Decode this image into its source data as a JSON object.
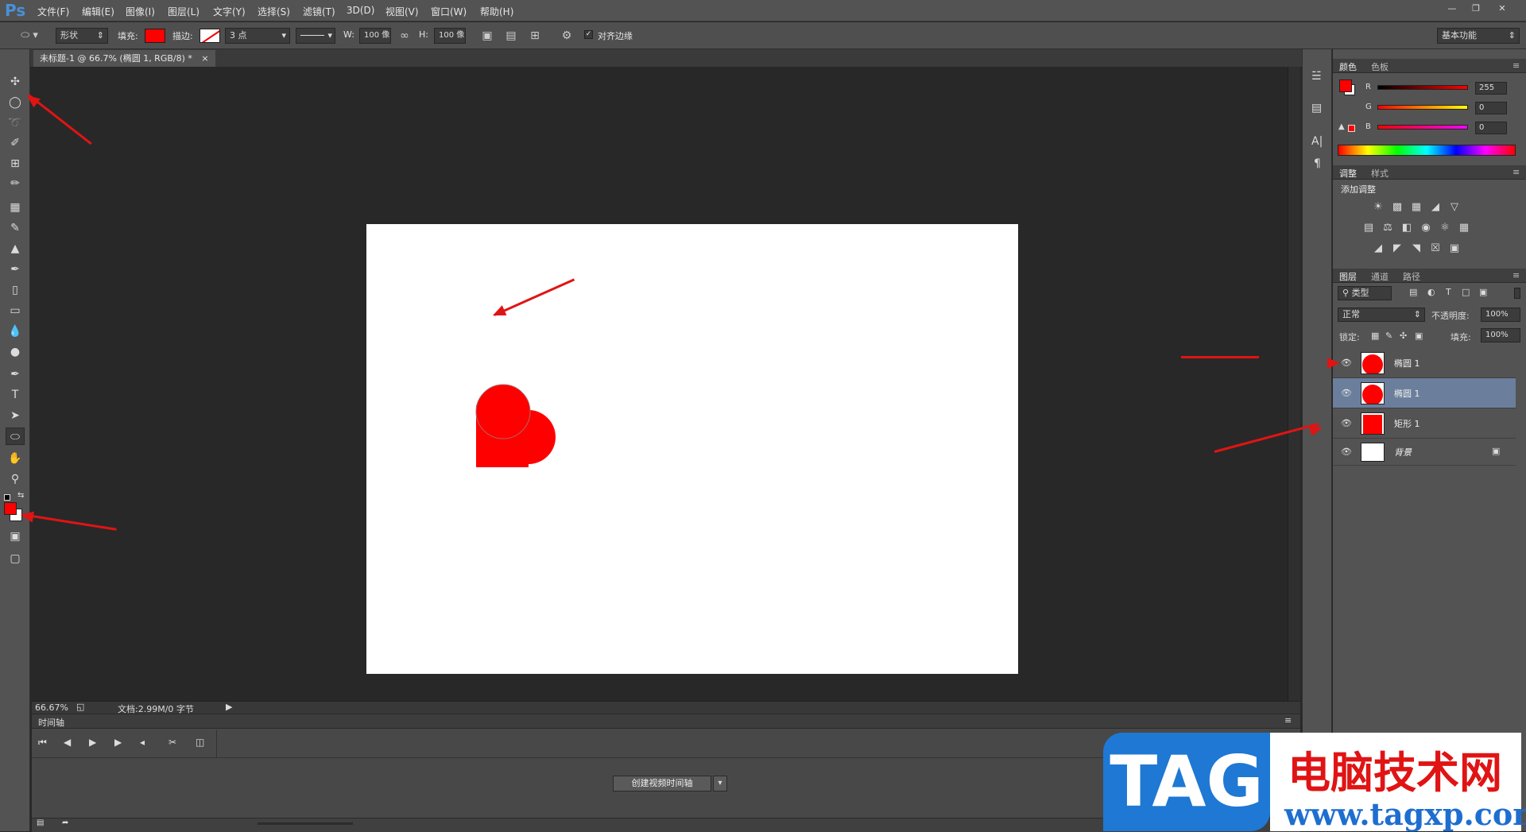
{
  "app": {
    "logo": "Ps"
  },
  "menu": [
    "文件(F)",
    "编辑(E)",
    "图像(I)",
    "图层(L)",
    "文字(Y)",
    "选择(S)",
    "滤镜(T)",
    "3D(D)",
    "视图(V)",
    "窗口(W)",
    "帮助(H)"
  ],
  "options": {
    "shape_mode": "形状",
    "fill_label": "填充:",
    "stroke_label": "描边:",
    "stroke_size": "3 点",
    "w_label": "W:",
    "w_value": "100 像",
    "h_label": "H:",
    "h_value": "100 像",
    "align_edges_label": "对齐边缘",
    "workspace": "基本功能",
    "fill_color": "#ff0000"
  },
  "document": {
    "tab_title": "未标题-1 @ 66.7% (椭圆 1, RGB/8) *",
    "zoom": "66.67%",
    "doc_info": "文档:2.99M/0 字节"
  },
  "timeline": {
    "tab": "时间轴",
    "create_button": "创建视频时间轴"
  },
  "color_panel": {
    "tabs": [
      "颜色",
      "色板"
    ],
    "channels": [
      {
        "label": "R",
        "value": "255"
      },
      {
        "label": "G",
        "value": "0"
      },
      {
        "label": "B",
        "value": "0"
      }
    ],
    "foreground": "#ff0000",
    "background": "#ffffff"
  },
  "adjust_panel": {
    "tabs": [
      "调整",
      "样式"
    ],
    "heading": "添加调整"
  },
  "layers_panel": {
    "tabs": [
      "图层",
      "通道",
      "路径"
    ],
    "filter_kind": "类型",
    "blend_mode": "正常",
    "opacity_label": "不透明度:",
    "opacity": "100%",
    "lock_label": "锁定:",
    "fill_label": "填充:",
    "fill": "100%",
    "layers": [
      {
        "name": "椭圆 1",
        "thumb": "ellipse",
        "selected": false
      },
      {
        "name": "椭圆 1",
        "thumb": "ellipse",
        "selected": true
      },
      {
        "name": "矩形 1",
        "thumb": "rect",
        "selected": false
      },
      {
        "name": "背景",
        "thumb": "bg",
        "selected": false,
        "locked": true
      }
    ]
  },
  "watermark": {
    "logo_text": "TAG",
    "site_name": "电脑技术网",
    "url": "www.tagxp.com"
  }
}
